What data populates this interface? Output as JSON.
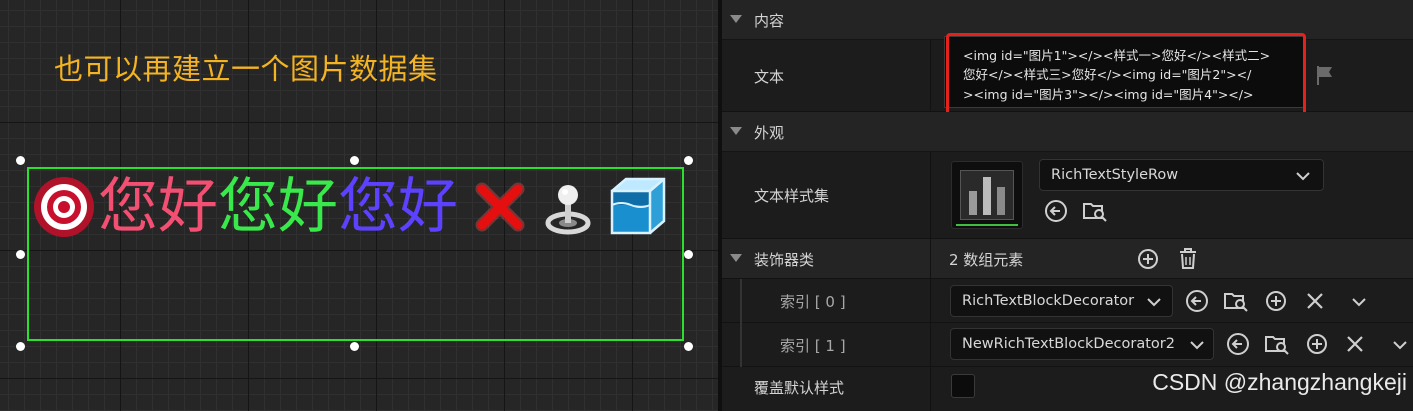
{
  "viewport": {
    "title": "也可以再建立一个图片数据集",
    "rich_text": [
      {
        "kind": "image",
        "icon": "target-icon"
      },
      {
        "kind": "text",
        "text": "您好",
        "color": "#f24f73"
      },
      {
        "kind": "text",
        "text": "您好",
        "color": "#39e84a"
      },
      {
        "kind": "text",
        "text": "您好",
        "color": "#5c42ff"
      },
      {
        "kind": "image",
        "icon": "red-x-icon"
      },
      {
        "kind": "image",
        "icon": "joystick-icon"
      },
      {
        "kind": "image",
        "icon": "water-cube-icon"
      }
    ]
  },
  "panel": {
    "content_section": "内容",
    "text_label": "文本",
    "text_value_lines": [
      "<img id=\"图片1\"></><样式一>您好</><样式二>",
      "您好</><样式三>您好</><img id=\"图片2\"></",
      "><img id=\"图片3\"></><img id=\"图片4\"></>"
    ],
    "appearance_section": "外观",
    "style_set_label": "文本样式集",
    "style_set_value": "RichTextStyleRow",
    "decorator_label": "装饰器类",
    "decorator_count": "2 数组元素",
    "index0_label": "索引 [ 0 ]",
    "index0_value": "RichTextBlockDecorator",
    "index1_label": "索引 [ 1 ]",
    "index1_value": "NewRichTextBlockDecorator2",
    "override_label": "覆盖默认样式"
  },
  "watermark": "CSDN @zhangzhangkeji",
  "colors": {
    "selection": "#2ee02e",
    "title": "#f4b321",
    "highlight": "#e6201a"
  }
}
